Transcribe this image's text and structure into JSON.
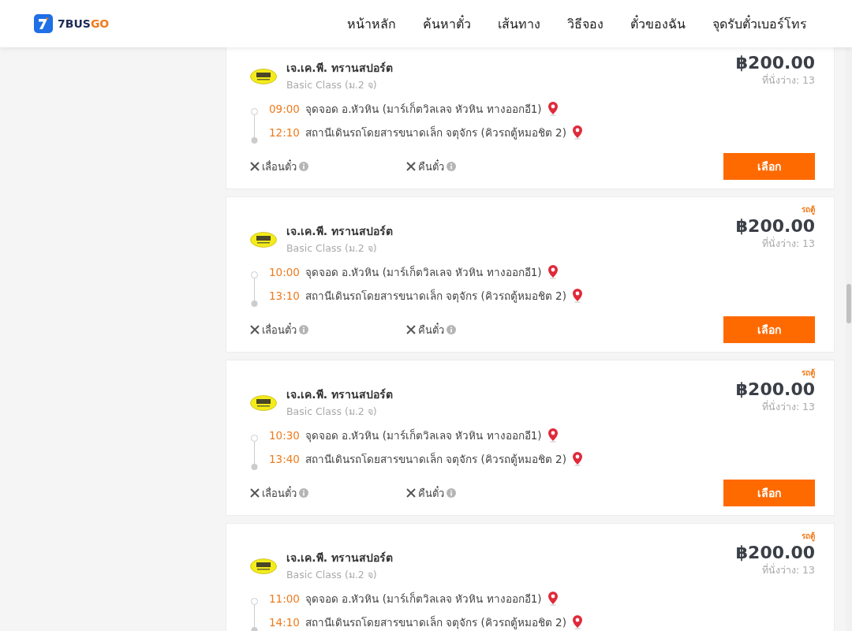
{
  "header": {
    "logo": {
      "part1": "7BUS",
      "part2": "GO"
    },
    "nav": [
      "หน้าหลัก",
      "ค้นหาตั๋ว",
      "เส้นทาง",
      "วิธีจอง",
      "ตั๋วของฉัน",
      "จุดรับตั๋วเบอร์โทร"
    ]
  },
  "trips": [
    {
      "operator": "เจ.เค.พี. ทรานสปอร์ต",
      "class": "Basic Class (ม.2 จ)",
      "price": "฿200.00",
      "seats": "ที่นั่งว่าง: 13",
      "stops": [
        {
          "time": "09:00",
          "place": "จุดจอด อ.หัวหิน (มาร์เก็ตวิลเลจ หัวหิน ทางออกอี1)"
        },
        {
          "time": "12:10",
          "place": "สถานีเดินรถโดยสารขนาดเล็ก จตุจักร (คิวรถตู้หมอชิต 2)"
        }
      ],
      "policies": [
        "เลื่อนตั๋ว",
        "คืนตั๋ว"
      ],
      "button": "เลือก"
    },
    {
      "tag": "รถตู้",
      "operator": "เจ.เค.พี. ทรานสปอร์ต",
      "class": "Basic Class (ม.2 จ)",
      "price": "฿200.00",
      "seats": "ที่นั่งว่าง: 13",
      "stops": [
        {
          "time": "10:00",
          "place": "จุดจอด อ.หัวหิน (มาร์เก็ตวิลเลจ หัวหิน ทางออกอี1)"
        },
        {
          "time": "13:10",
          "place": "สถานีเดินรถโดยสารขนาดเล็ก จตุจักร (คิวรถตู้หมอชิต 2)"
        }
      ],
      "policies": [
        "เลื่อนตั๋ว",
        "คืนตั๋ว"
      ],
      "button": "เลือก"
    },
    {
      "tag": "รถตู้",
      "operator": "เจ.เค.พี. ทรานสปอร์ต",
      "class": "Basic Class (ม.2 จ)",
      "price": "฿200.00",
      "seats": "ที่นั่งว่าง: 13",
      "stops": [
        {
          "time": "10:30",
          "place": "จุดจอด อ.หัวหิน (มาร์เก็ตวิลเลจ หัวหิน ทางออกอี1)"
        },
        {
          "time": "13:40",
          "place": "สถานีเดินรถโดยสารขนาดเล็ก จตุจักร (คิวรถตู้หมอชิต 2)"
        }
      ],
      "policies": [
        "เลื่อนตั๋ว",
        "คืนตั๋ว"
      ],
      "button": "เลือก"
    },
    {
      "tag": "รถตู้",
      "operator": "เจ.เค.พี. ทรานสปอร์ต",
      "class": "Basic Class (ม.2 จ)",
      "price": "฿200.00",
      "seats": "ที่นั่งว่าง: 13",
      "stops": [
        {
          "time": "11:00",
          "place": "จุดจอด อ.หัวหิน (มาร์เก็ตวิลเลจ หัวหิน ทางออกอี1)"
        },
        {
          "time": "14:10",
          "place": "สถานีเดินรถโดยสารขนาดเล็ก จตุจักร (คิวรถตู้หมอชิต 2)"
        }
      ]
    }
  ]
}
